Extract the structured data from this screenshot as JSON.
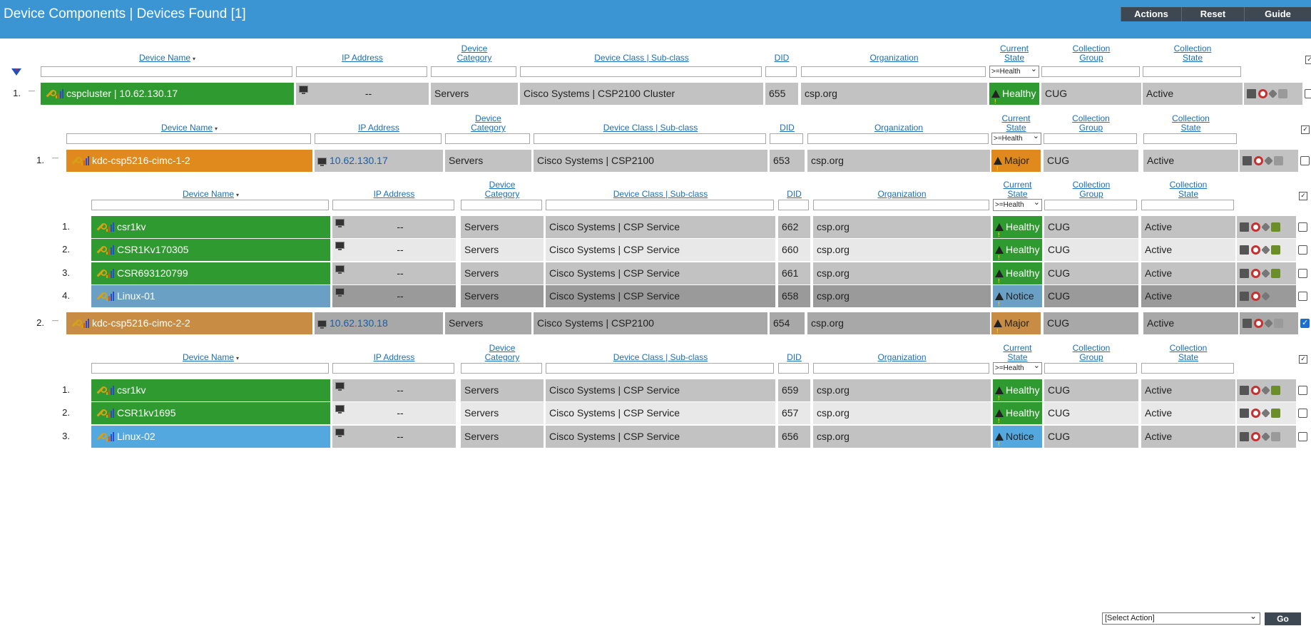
{
  "header": {
    "title": "Device Components | Devices Found [1]",
    "buttons": {
      "actions": "Actions",
      "reset": "Reset",
      "guide": "Guide"
    }
  },
  "columns": {
    "name": "Device Name",
    "ip": "IP Address",
    "category": "Device Category",
    "class": "Device Class | Sub-class",
    "did": "DID",
    "org": "Organization",
    "state": "Current State",
    "group": "Collection Group",
    "cstate": "Collection State",
    "state_filter": ">=Health"
  },
  "icons": [
    "filter-funnel-icon",
    "wrench-icon",
    "bar-graph-icon",
    "monitor-icon",
    "warning-icon",
    "print-icon",
    "lifebuoy-icon",
    "tag-icon",
    "group-icon"
  ],
  "colors": {
    "healthy": "#2f9a2f",
    "major": "#e08a1e",
    "notice": "#62a1cc",
    "header": "#3b95d3"
  },
  "rows": {
    "top": {
      "num": "1.",
      "name": "cspcluster | 10.62.130.17",
      "ip": "--",
      "category": "Servers",
      "class": "Cisco Systems | CSP2100 Cluster",
      "did": "655",
      "org": "csp.org",
      "state": "Healthy",
      "group": "CUG",
      "cstate": "Active"
    },
    "c1": {
      "num": "1.",
      "name": "kdc-csp5216-cimc-1-2",
      "ip": "10.62.130.17",
      "category": "Servers",
      "class": "Cisco Systems | CSP2100",
      "did": "653",
      "org": "csp.org",
      "state": "Major",
      "group": "CUG",
      "cstate": "Active"
    },
    "c1a": {
      "num": "1.",
      "name": "csr1kv",
      "ip": "--",
      "category": "Servers",
      "class": "Cisco Systems | CSP Service",
      "did": "662",
      "org": "csp.org",
      "state": "Healthy",
      "group": "CUG",
      "cstate": "Active"
    },
    "c1b": {
      "num": "2.",
      "name": "CSR1Kv170305",
      "ip": "--",
      "category": "Servers",
      "class": "Cisco Systems | CSP Service",
      "did": "660",
      "org": "csp.org",
      "state": "Healthy",
      "group": "CUG",
      "cstate": "Active"
    },
    "c1c": {
      "num": "3.",
      "name": "CSR693120799",
      "ip": "--",
      "category": "Servers",
      "class": "Cisco Systems | CSP Service",
      "did": "661",
      "org": "csp.org",
      "state": "Healthy",
      "group": "CUG",
      "cstate": "Active"
    },
    "c1d": {
      "num": "4.",
      "name": "Linux-01",
      "ip": "--",
      "category": "Servers",
      "class": "Cisco Systems | CSP Service",
      "did": "658",
      "org": "csp.org",
      "state": "Notice",
      "group": "CUG",
      "cstate": "Active"
    },
    "c2": {
      "num": "2.",
      "name": "kdc-csp5216-cimc-2-2",
      "ip": "10.62.130.18",
      "category": "Servers",
      "class": "Cisco Systems | CSP2100",
      "did": "654",
      "org": "csp.org",
      "state": "Major",
      "group": "CUG",
      "cstate": "Active"
    },
    "c2a": {
      "num": "1.",
      "name": "csr1kv",
      "ip": "--",
      "category": "Servers",
      "class": "Cisco Systems | CSP Service",
      "did": "659",
      "org": "csp.org",
      "state": "Healthy",
      "group": "CUG",
      "cstate": "Active"
    },
    "c2b": {
      "num": "2.",
      "name": "CSR1kv1695",
      "ip": "--",
      "category": "Servers",
      "class": "Cisco Systems | CSP Service",
      "did": "657",
      "org": "csp.org",
      "state": "Healthy",
      "group": "CUG",
      "cstate": "Active"
    },
    "c2c": {
      "num": "3.",
      "name": "Linux-02",
      "ip": "--",
      "category": "Servers",
      "class": "Cisco Systems | CSP Service",
      "did": "656",
      "org": "csp.org",
      "state": "Notice",
      "group": "CUG",
      "cstate": "Active"
    }
  },
  "footer": {
    "select_action": "[Select Action]",
    "go": "Go"
  }
}
